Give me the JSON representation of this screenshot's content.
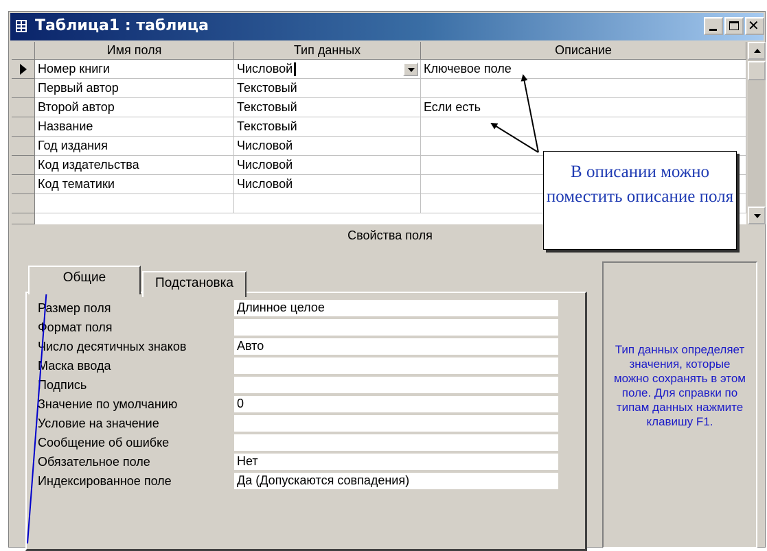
{
  "window": {
    "title": "Таблица1 : таблица"
  },
  "grid": {
    "columns": [
      "Имя поля",
      "Тип данных",
      "Описание"
    ],
    "rows": [
      {
        "name": "Номер книги",
        "type": "Числовой",
        "desc": "Ключевое поле"
      },
      {
        "name": "Первый автор",
        "type": "Текстовый",
        "desc": ""
      },
      {
        "name": "Второй автор",
        "type": "Текстовый",
        "desc": "Если есть"
      },
      {
        "name": "Название",
        "type": "Текстовый",
        "desc": ""
      },
      {
        "name": "Год издания",
        "type": "Числовой",
        "desc": ""
      },
      {
        "name": "Код издательства",
        "type": "Числовой",
        "desc": ""
      },
      {
        "name": "Код тематики",
        "type": "Числовой",
        "desc": ""
      },
      {
        "name": "",
        "type": "",
        "desc": ""
      }
    ]
  },
  "properties": {
    "title": "Свойства поля",
    "tabs": [
      "Общие",
      "Подстановка"
    ],
    "fields": [
      {
        "label": "Размер поля",
        "value": "Длинное целое"
      },
      {
        "label": "Формат поля",
        "value": ""
      },
      {
        "label": "Число десятичных знаков",
        "value": "Авто"
      },
      {
        "label": "Маска ввода",
        "value": ""
      },
      {
        "label": "Подпись",
        "value": ""
      },
      {
        "label": "Значение по умолчанию",
        "value": "0"
      },
      {
        "label": "Условие на значение",
        "value": ""
      },
      {
        "label": "Сообщение об ошибке",
        "value": ""
      },
      {
        "label": "Обязательное поле",
        "value": "Нет"
      },
      {
        "label": "Индексированное поле",
        "value": "Да (Допускаются совпадения)"
      }
    ]
  },
  "help_text": "Тип данных определяет значения, которые можно сохранять в этом поле.  Для справки по типам данных нажмите клавишу F1.",
  "callout": {
    "text": "В описании можно поместить описание поля"
  },
  "colors": {
    "title_bar": "#0a246a",
    "help_text": "#1a1ac8",
    "callout_text": "#1f3bb3",
    "arrow": "#0000cc"
  },
  "icons": [
    "table-icon",
    "minimize-icon",
    "maximize-icon",
    "close-icon",
    "record-pointer-icon",
    "dropdown-arrow-icon",
    "scroll-up-icon",
    "scroll-down-icon"
  ]
}
